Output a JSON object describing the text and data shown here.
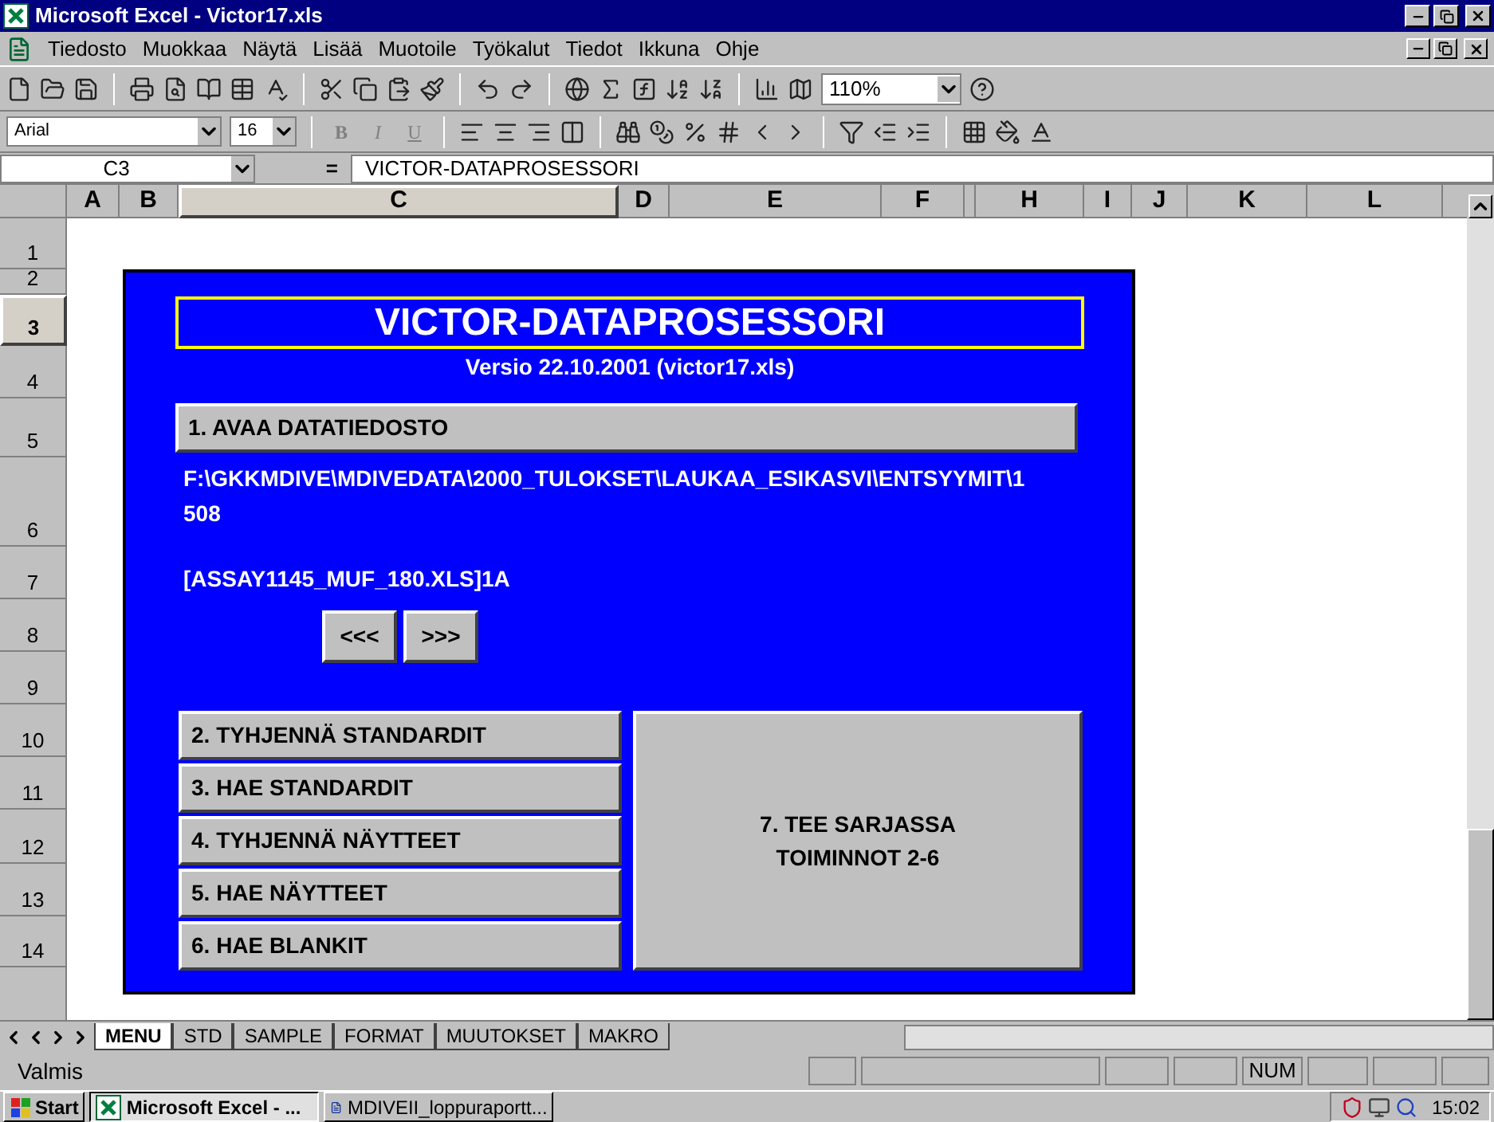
{
  "window": {
    "title": "Microsoft Excel - Victor17.xls"
  },
  "menu": [
    "Tiedosto",
    "Muokkaa",
    "Näytä",
    "Lisää",
    "Muotoile",
    "Työkalut",
    "Tiedot",
    "Ikkuna",
    "Ohje"
  ],
  "toolbar": {
    "zoom": "110%"
  },
  "format_toolbar": {
    "font": "Arial",
    "size": "16",
    "style_buttons": [
      "B",
      "I",
      "U"
    ]
  },
  "formula_bar": {
    "name_box": "C3",
    "equals": "=",
    "formula": "VICTOR-DATAPROSESSORI"
  },
  "columns": [
    {
      "label": "A",
      "selected": false
    },
    {
      "label": "B",
      "selected": false
    },
    {
      "label": "C",
      "selected": true
    },
    {
      "label": "D",
      "selected": false
    },
    {
      "label": "E",
      "selected": false
    },
    {
      "label": "F",
      "selected": false
    },
    {
      "label": "H",
      "selected": false
    },
    {
      "label": "I",
      "selected": false
    },
    {
      "label": "J",
      "selected": false
    },
    {
      "label": "K",
      "selected": false
    },
    {
      "label": "L",
      "selected": false
    }
  ],
  "rows": [
    {
      "label": "1",
      "selected": false
    },
    {
      "label": "2",
      "selected": false
    },
    {
      "label": "3",
      "selected": true
    },
    {
      "label": "4",
      "selected": false
    },
    {
      "label": "5",
      "selected": false
    },
    {
      "label": "6",
      "selected": false
    },
    {
      "label": "7",
      "selected": false
    },
    {
      "label": "8",
      "selected": false
    },
    {
      "label": "9",
      "selected": false
    },
    {
      "label": "10",
      "selected": false
    },
    {
      "label": "11",
      "selected": false
    },
    {
      "label": "12",
      "selected": false
    },
    {
      "label": "13",
      "selected": false
    },
    {
      "label": "14",
      "selected": false
    }
  ],
  "panel": {
    "title": "VICTOR-DATAPROSESSORI",
    "version": "Versio 22.10.2001 (victor17.xls)",
    "open_button": "1. AVAA DATATIEDOSTO",
    "path": "F:\\GKKMDIVE\\MDIVEDATA\\2000_TULOKSET\\LAUKAA_ESIKASVI\\ENTSYYMIT\\1508",
    "sheet_ref": "[ASSAY1145_MUF_180.XLS]1A",
    "nav_buttons": [
      "<<<",
      ">>>"
    ],
    "action_buttons": [
      "2. TYHJENNÄ STANDARDIT",
      "3. HAE STANDARDIT",
      "4. TYHJENNÄ NÄYTTEET",
      "5. HAE NÄYTTEET",
      "6. HAE BLANKIT"
    ],
    "batch_button": "7. TEE SARJASSA TOIMINNOT 2-6"
  },
  "sheet_tabs": [
    {
      "label": "MENU",
      "selected": true
    },
    {
      "label": "STD",
      "selected": false
    },
    {
      "label": "SAMPLE",
      "selected": false
    },
    {
      "label": "FORMAT",
      "selected": false
    },
    {
      "label": "MUUTOKSET",
      "selected": false
    },
    {
      "label": "MAKRO",
      "selected": false
    }
  ],
  "status_bar": {
    "status": "Valmis",
    "indicator": "NUM"
  },
  "taskbar": {
    "start": "Start",
    "tasks": [
      {
        "label": "Microsoft Excel - ...",
        "selected": true
      },
      {
        "label": "MDIVEII_loppuraportt...",
        "selected": false
      }
    ],
    "clock": "15:02"
  }
}
